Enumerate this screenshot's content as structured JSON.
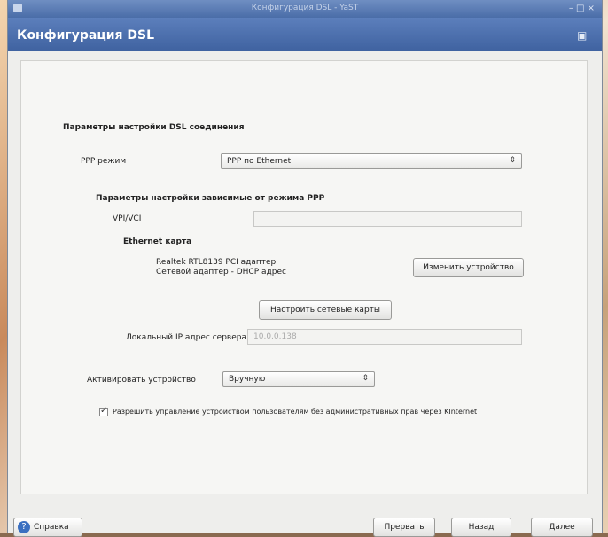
{
  "window": {
    "title": "Конфигурация DSL - YaST",
    "controls": "– □ ×"
  },
  "header": {
    "title": "Конфигурация DSL"
  },
  "form": {
    "section_title": "Параметры настройки DSL соединения",
    "ppp_mode_label": "PPP режим",
    "ppp_mode_value": "PPP по Ethernet",
    "ppp_subsection_title": "Параметры настройки зависимые от режима PPP",
    "vpi_vci_label": "VPI/VCI",
    "vpi_vci_value": "",
    "ethernet_card_label": "Ethernet карта",
    "ethernet_card_line1": "Realtek RTL8139 PCI адаптер",
    "ethernet_card_line2": "Сетевой адаптер - DHCP адрес",
    "change_device_button": "Изменить устройство",
    "configure_network_button": "Настроить сетевые карты",
    "ip_label": "Локальный IP адрес сервера",
    "ip_value": "10.0.0.138",
    "activate_label": "Активировать устройство",
    "activate_value": "Вручную",
    "checkbox_label": "Разрешить управление устройством пользователям без административных прав через KInternet",
    "checkbox_checked": true
  },
  "footer": {
    "help_button": "Справка",
    "back_button": "Прервать",
    "abort_button": "Назад",
    "next_button": "Далее"
  }
}
